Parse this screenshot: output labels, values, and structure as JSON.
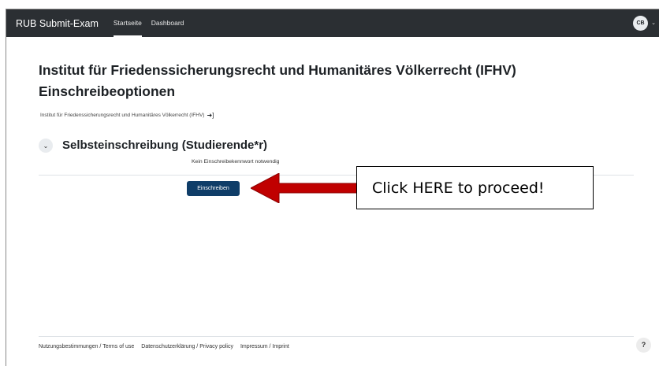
{
  "navbar": {
    "brand": "RUB Submit-Exam",
    "links": [
      "Startseite",
      "Dashboard"
    ],
    "avatar_initials": "CB",
    "avatar_menu_icon": "chevron-down-icon"
  },
  "page": {
    "title": "Institut für Friedenssicherungsrecht und Humanitäres Völkerrecht (IFHV)",
    "subtitle": "Einschreibeoptionen",
    "breadcrumb": "Institut für Friedenssicherungsrecht und Humanitäres Völkerrecht (IFHV)",
    "breadcrumb_icon": "enter-icon"
  },
  "section": {
    "title": "Selbsteinschreibung (Studierende*r)",
    "info": "Kein Einschreibekennwort notwendig",
    "enroll_label": "Einschreiben"
  },
  "annotation": {
    "text": "Click HERE to proceed!",
    "arrow_color": "#c00000"
  },
  "footer": {
    "links": [
      "Nutzungsbestimmungen / Terms of use",
      "Datenschutzerklärung / Privacy policy",
      "Impressum / Imprint"
    ],
    "help_label": "?"
  },
  "colors": {
    "navbar": "#2b2f33",
    "button": "#0f3d68"
  }
}
